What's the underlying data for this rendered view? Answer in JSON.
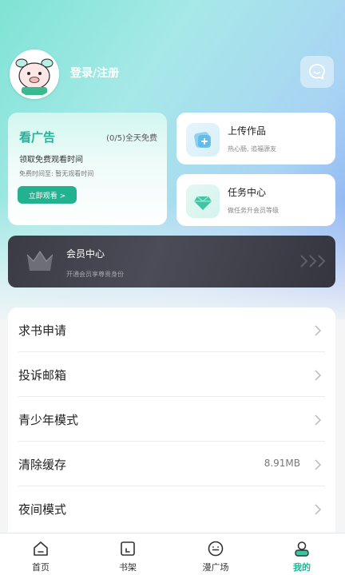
{
  "header": {
    "login_label": "登录/注册",
    "avatar_badge": "小鹿"
  },
  "ad_card": {
    "title": "看广告",
    "quota": "(0/5)全天免费",
    "line1": "领取免费观看时间",
    "line2": "免费时间至:  暂无观看时间",
    "button": "立即观看 >"
  },
  "upload_card": {
    "title": "上传作品",
    "subtitle": "热心肠, 追福源友"
  },
  "task_card": {
    "title": "任务中心",
    "subtitle": "做任务升会员等级"
  },
  "vip_card": {
    "title": "会员中心",
    "subtitle": "开通会员享尊贵身份"
  },
  "menu": {
    "items": [
      {
        "label": "求书申请",
        "value": ""
      },
      {
        "label": "投诉邮箱",
        "value": ""
      },
      {
        "label": "青少年模式",
        "value": ""
      },
      {
        "label": "清除缓存",
        "value": "8.91MB"
      },
      {
        "label": "夜间模式",
        "value": ""
      }
    ]
  },
  "tabbar": {
    "tabs": [
      {
        "label": "首页",
        "icon": "home-icon"
      },
      {
        "label": "书架",
        "icon": "bookshelf-icon"
      },
      {
        "label": "漫广场",
        "icon": "comic-square-icon"
      },
      {
        "label": "我的",
        "icon": "profile-icon",
        "active": true
      }
    ]
  },
  "colors": {
    "accent": "#1fb497",
    "gradient_start": "#7fe3d4",
    "gradient_end": "#7fa4f2",
    "vip_bg": "#3f4049"
  }
}
